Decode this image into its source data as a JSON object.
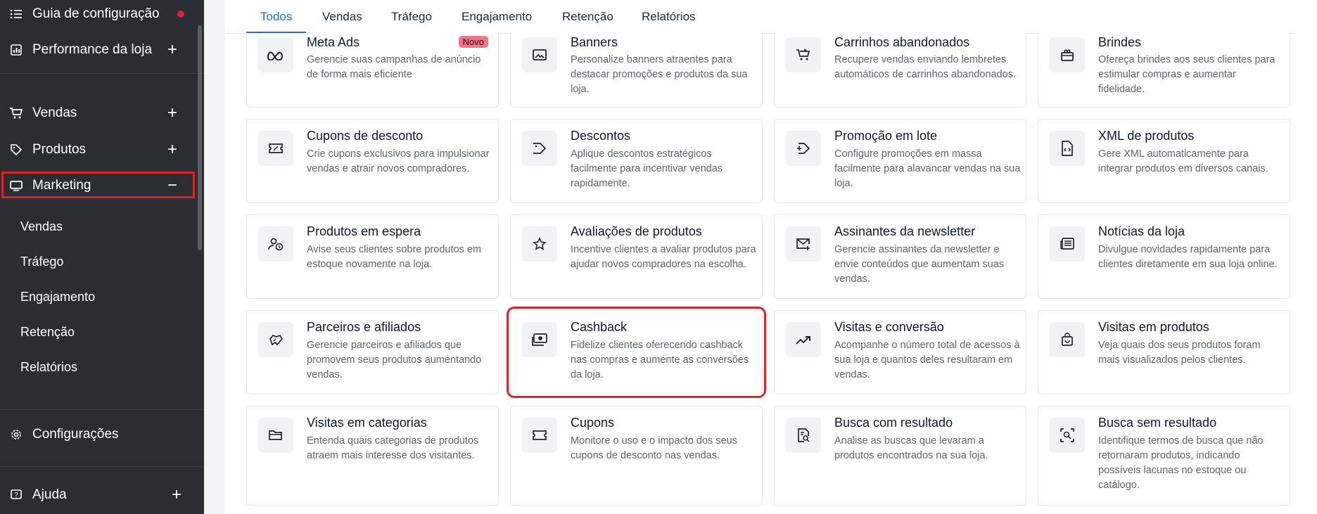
{
  "sidebar": {
    "items": [
      {
        "label": "Guia de configuração",
        "icon": "list-icon",
        "action": ""
      },
      {
        "label": "Performance da loja",
        "icon": "store-chart-icon",
        "action": "+"
      },
      {
        "label": "Vendas",
        "icon": "cart-icon",
        "action": "+"
      },
      {
        "label": "Produtos",
        "icon": "tag-icon",
        "action": "+"
      },
      {
        "label": "Marketing",
        "icon": "monitor-icon",
        "action": "−"
      }
    ],
    "marketing_sub": [
      "Vendas",
      "Tráfego",
      "Engajamento",
      "Retenção",
      "Relatórios"
    ],
    "bottom": [
      {
        "label": "Configurações",
        "icon": "gear-icon",
        "action": ""
      },
      {
        "label": "Ajuda",
        "icon": "help-icon",
        "action": "+"
      }
    ]
  },
  "tabs": [
    "Todos",
    "Vendas",
    "Tráfego",
    "Engajamento",
    "Retenção",
    "Relatórios"
  ],
  "active_tab": "Todos",
  "cards": [
    {
      "title": "Meta Ads",
      "desc": "Gerencie suas campanhas de anúncio de forma mais eficiente",
      "icon": "meta-icon",
      "badge": "Novo"
    },
    {
      "title": "Banners",
      "desc": "Personalize banners atraentes para destacar promoções e produtos da sua loja.",
      "icon": "image-icon"
    },
    {
      "title": "Carrinhos abandonados",
      "desc": "Recupere vendas enviando lembretes automáticos de carrinhos abandonados.",
      "icon": "cart-x-icon"
    },
    {
      "title": "Brindes",
      "desc": "Ofereça brindes aos seus clientes para estimular compras e aumentar fidelidade.",
      "icon": "gift-icon"
    },
    {
      "title": "Cupons de desconto",
      "desc": "Crie cupons exclusivos para impulsionar vendas e atrair novos compradores.",
      "icon": "coupon-icon"
    },
    {
      "title": "Descontos",
      "desc": "Aplique descontos estratégicos facilmente para incentivar vendas rapidamente.",
      "icon": "discount-tag-icon"
    },
    {
      "title": "Promoção em lote",
      "desc": "Configure promoções em massa facilmente para alavancar vendas na sua loja.",
      "icon": "tag-plus-icon"
    },
    {
      "title": "XML de produtos",
      "desc": "Gere XML automaticamente para integrar produtos em diversos canais.",
      "icon": "xml-file-icon"
    },
    {
      "title": "Produtos em espera",
      "desc": "Avise seus clientes sobre produtos em estoque novamente na loja.",
      "icon": "user-clock-icon"
    },
    {
      "title": "Avaliações de produtos",
      "desc": "Incentive clientes a avaliar produtos para ajudar novos compradores na escolha.",
      "icon": "star-icon"
    },
    {
      "title": "Assinantes da newsletter",
      "desc": "Gerencie assinantes da newsletter e envie conteúdos que aumentam suas vendas.",
      "icon": "mail-plus-icon"
    },
    {
      "title": "Notícias da loja",
      "desc": "Divulgue novidades rapidamente para clientes diretamente em sua loja online.",
      "icon": "news-icon"
    },
    {
      "title": "Parceiros e afiliados",
      "desc": "Gerencie parceiros e afiliados que promovem seus produtos aumentando vendas.",
      "icon": "handshake-icon"
    },
    {
      "title": "Cashback",
      "desc": "Fidelize clientes oferecendo cashback nas compras e aumente as conversões da loja.",
      "icon": "cash-icon"
    },
    {
      "title": "Visitas e conversão",
      "desc": "Acompanhe o número total de acessos à sua loja e quantos deles resultaram em vendas.",
      "icon": "trend-up-icon"
    },
    {
      "title": "Visitas em produtos",
      "desc": "Veja quais dos seus produtos foram mais visualizados pelos clientes.",
      "icon": "bag-icon"
    },
    {
      "title": "Visitas em categorias",
      "desc": "Entenda quais categorias de produtos atraem mais interesse dos visitantes.",
      "icon": "folder-icon"
    },
    {
      "title": "Cupons",
      "desc": "Monitore o uso e o impacto dos seus cupons de desconto nas vendas.",
      "icon": "ticket-icon"
    },
    {
      "title": "Busca com resultado",
      "desc": "Analise as buscas que levaram a produtos encontrados na sua loja.",
      "icon": "search-doc-icon"
    },
    {
      "title": "Busca sem resultado",
      "desc": "Identifique termos de busca que não retornaram produtos, indicando possíveis lacunas no estoque ou catálogo.",
      "icon": "search-frame-icon"
    }
  ]
}
